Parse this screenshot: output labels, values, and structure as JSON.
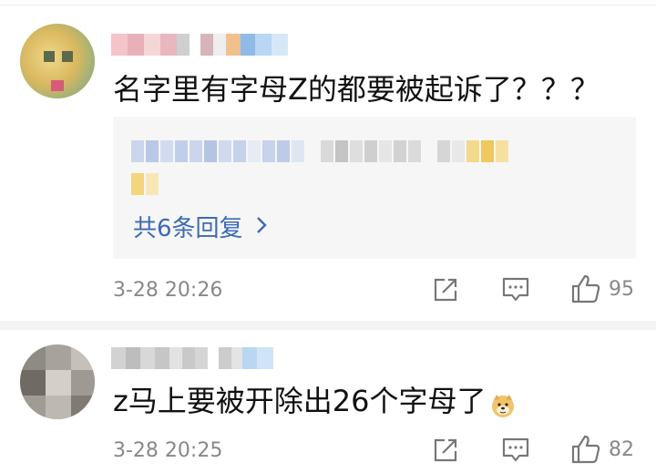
{
  "comments": [
    {
      "text": "名字里有字母Z的都要被起诉了？？？",
      "reply_count_label": "共6条回复",
      "time": "3-28 20:26",
      "likes": "95"
    },
    {
      "text": "z马上要被开除出26个字母了",
      "time": "3-28 20:25",
      "likes": "82"
    }
  ],
  "icons": {
    "share": "share-icon",
    "comment": "comment-icon",
    "like": "thumbs-up-icon",
    "chevron": "chevron-right-icon",
    "emoji": "doge-emoji-icon"
  },
  "colors": {
    "link": "#3d6bb3",
    "meta": "#888888",
    "reply_bg": "#f6f6f6"
  }
}
